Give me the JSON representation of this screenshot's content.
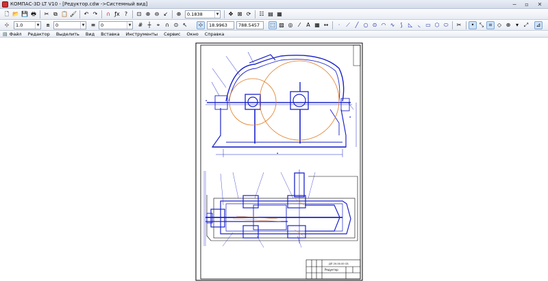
{
  "window": {
    "title": "КОМПАС-3D LT V10 - [Редуктор.cdw ->Системный вид]",
    "controls": [
      "−",
      "▫",
      "✕"
    ]
  },
  "toolbar_top": {
    "icons": [
      "new-file-icon",
      "open-file-icon",
      "save-icon",
      "print-icon",
      "cut-icon",
      "copy-icon",
      "paste-icon",
      "format-brush-icon",
      "undo-icon",
      "redo-icon",
      "magnet-icon",
      "variables-icon",
      "help-pointer-icon",
      "zoom-window-icon",
      "zoom-in-icon",
      "zoom-out-icon",
      "zoom-previous-icon",
      "zoom-scale-icon",
      "pan-icon",
      "zoom-fit-icon",
      "refresh-icon",
      "tree-icon",
      "manager-icon"
    ],
    "zoom_value": "0.1838"
  },
  "toolbar_props": {
    "step_value": "1.0",
    "layer_value": "0",
    "style_value": "0",
    "coord_x": "18.9963",
    "coord_y": "788.5457"
  },
  "menu": [
    "Файл",
    "Редактор",
    "Выделить",
    "Вид",
    "Вставка",
    "Инструменты",
    "Сервис",
    "Окно",
    "Справка"
  ],
  "drawing": {
    "stamp_title": "Редуктор",
    "stamp_code": "ДП 20.00.00 СБ"
  }
}
